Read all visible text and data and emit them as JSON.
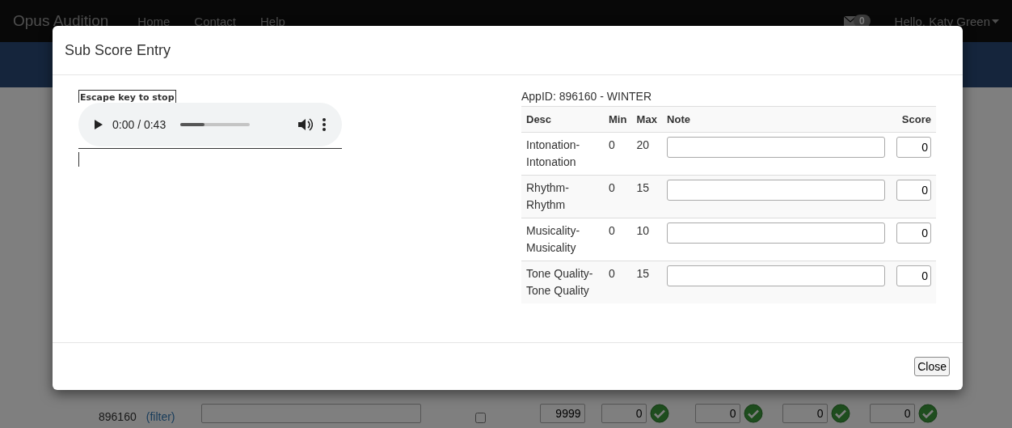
{
  "navbar": {
    "brand": "Opus Audition",
    "links": [
      "Home",
      "Contact",
      "Help"
    ],
    "message_count": "0",
    "user": "Hello, Katy Green"
  },
  "background_row": {
    "app_id": "896160",
    "filter_link": "(filter)",
    "checked": false,
    "total": "9999",
    "scores": [
      "0",
      "0",
      "0",
      "0"
    ]
  },
  "modal": {
    "title": "Sub Score Entry",
    "escape_note": "Escape key to stop",
    "player": {
      "time": "0:00 / 0:43",
      "level": 0.35
    },
    "app_label": "AppID: 896160 - WINTER",
    "columns": [
      "Desc",
      "Min",
      "Max",
      "Note",
      "Score"
    ],
    "rows": [
      {
        "desc": "Intonation-Intonation",
        "min": "0",
        "max": "20",
        "score": "0"
      },
      {
        "desc": "Rhythm-Rhythm",
        "min": "0",
        "max": "15",
        "score": "0"
      },
      {
        "desc": "Musicality-Musicality",
        "min": "0",
        "max": "10",
        "score": "0"
      },
      {
        "desc": "Tone Quality-Tone Quality",
        "min": "0",
        "max": "15",
        "score": "0"
      }
    ],
    "close_button": "Close"
  }
}
